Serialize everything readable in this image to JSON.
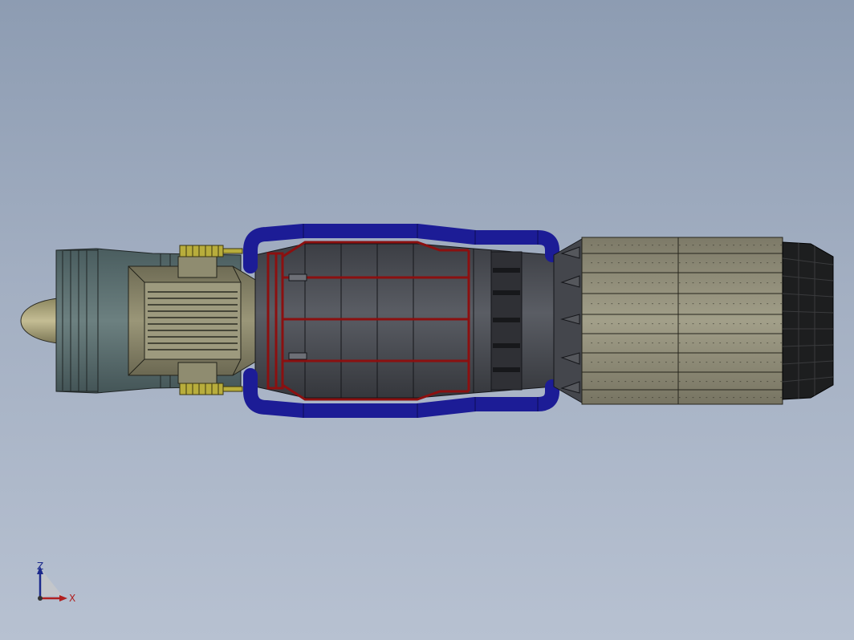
{
  "viewport": {
    "background_top": "#8d9cb2",
    "background_bottom": "#b7c1d1"
  },
  "model": {
    "colors": {
      "nose_cone": "#a9a27a",
      "intake": "#55696a",
      "accessory_body": "#8a866a",
      "bellows": "#b8ad3c",
      "core_body": "#474a52",
      "red_frame": "#8b1010",
      "blue_pipes": "#1c1c96",
      "afterburner_skin": "#8f8c78",
      "nozzle": "#1d1e1f"
    }
  },
  "triad": {
    "z_label": "Z",
    "x_label": "X",
    "z_color": "#1c2a8c",
    "x_color": "#b02020"
  }
}
